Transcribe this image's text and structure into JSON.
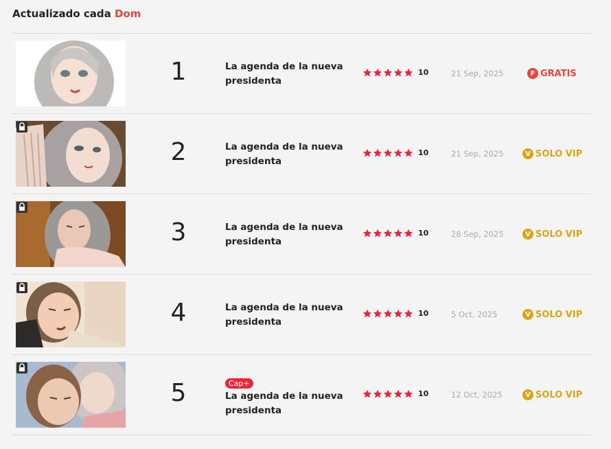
{
  "header": {
    "prefix": "Actualizado cada",
    "day": "Dom"
  },
  "colors": {
    "accent": "#e8453c",
    "vip": "#d9a512",
    "star": "#e8273d",
    "date": "#aaaaaa"
  },
  "episodes": [
    {
      "number": "1",
      "title": "La agenda de la nueva presidenta",
      "rating": "10",
      "stars": 5,
      "date": "21 Sep, 2025",
      "status": "GRATIS",
      "status_icon": "F",
      "locked": false,
      "cap_badge": ""
    },
    {
      "number": "2",
      "title": "La agenda de la nueva presidenta",
      "rating": "10",
      "stars": 5,
      "date": "21 Sep, 2025",
      "status": "SOLO VIP",
      "status_icon": "V",
      "locked": true,
      "cap_badge": ""
    },
    {
      "number": "3",
      "title": "La agenda de la nueva presidenta",
      "rating": "10",
      "stars": 5,
      "date": "28 Sep, 2025",
      "status": "SOLO VIP",
      "status_icon": "V",
      "locked": true,
      "cap_badge": ""
    },
    {
      "number": "4",
      "title": "La agenda de la nueva presidenta",
      "rating": "10",
      "stars": 5,
      "date": "5 Oct, 2025",
      "status": "SOLO VIP",
      "status_icon": "V",
      "locked": true,
      "cap_badge": ""
    },
    {
      "number": "5",
      "title": "La agenda de la nueva presidenta",
      "rating": "10",
      "stars": 5,
      "date": "12 Oct, 2025",
      "status": "SOLO VIP",
      "status_icon": "V",
      "locked": true,
      "cap_badge": "Cap+"
    }
  ]
}
